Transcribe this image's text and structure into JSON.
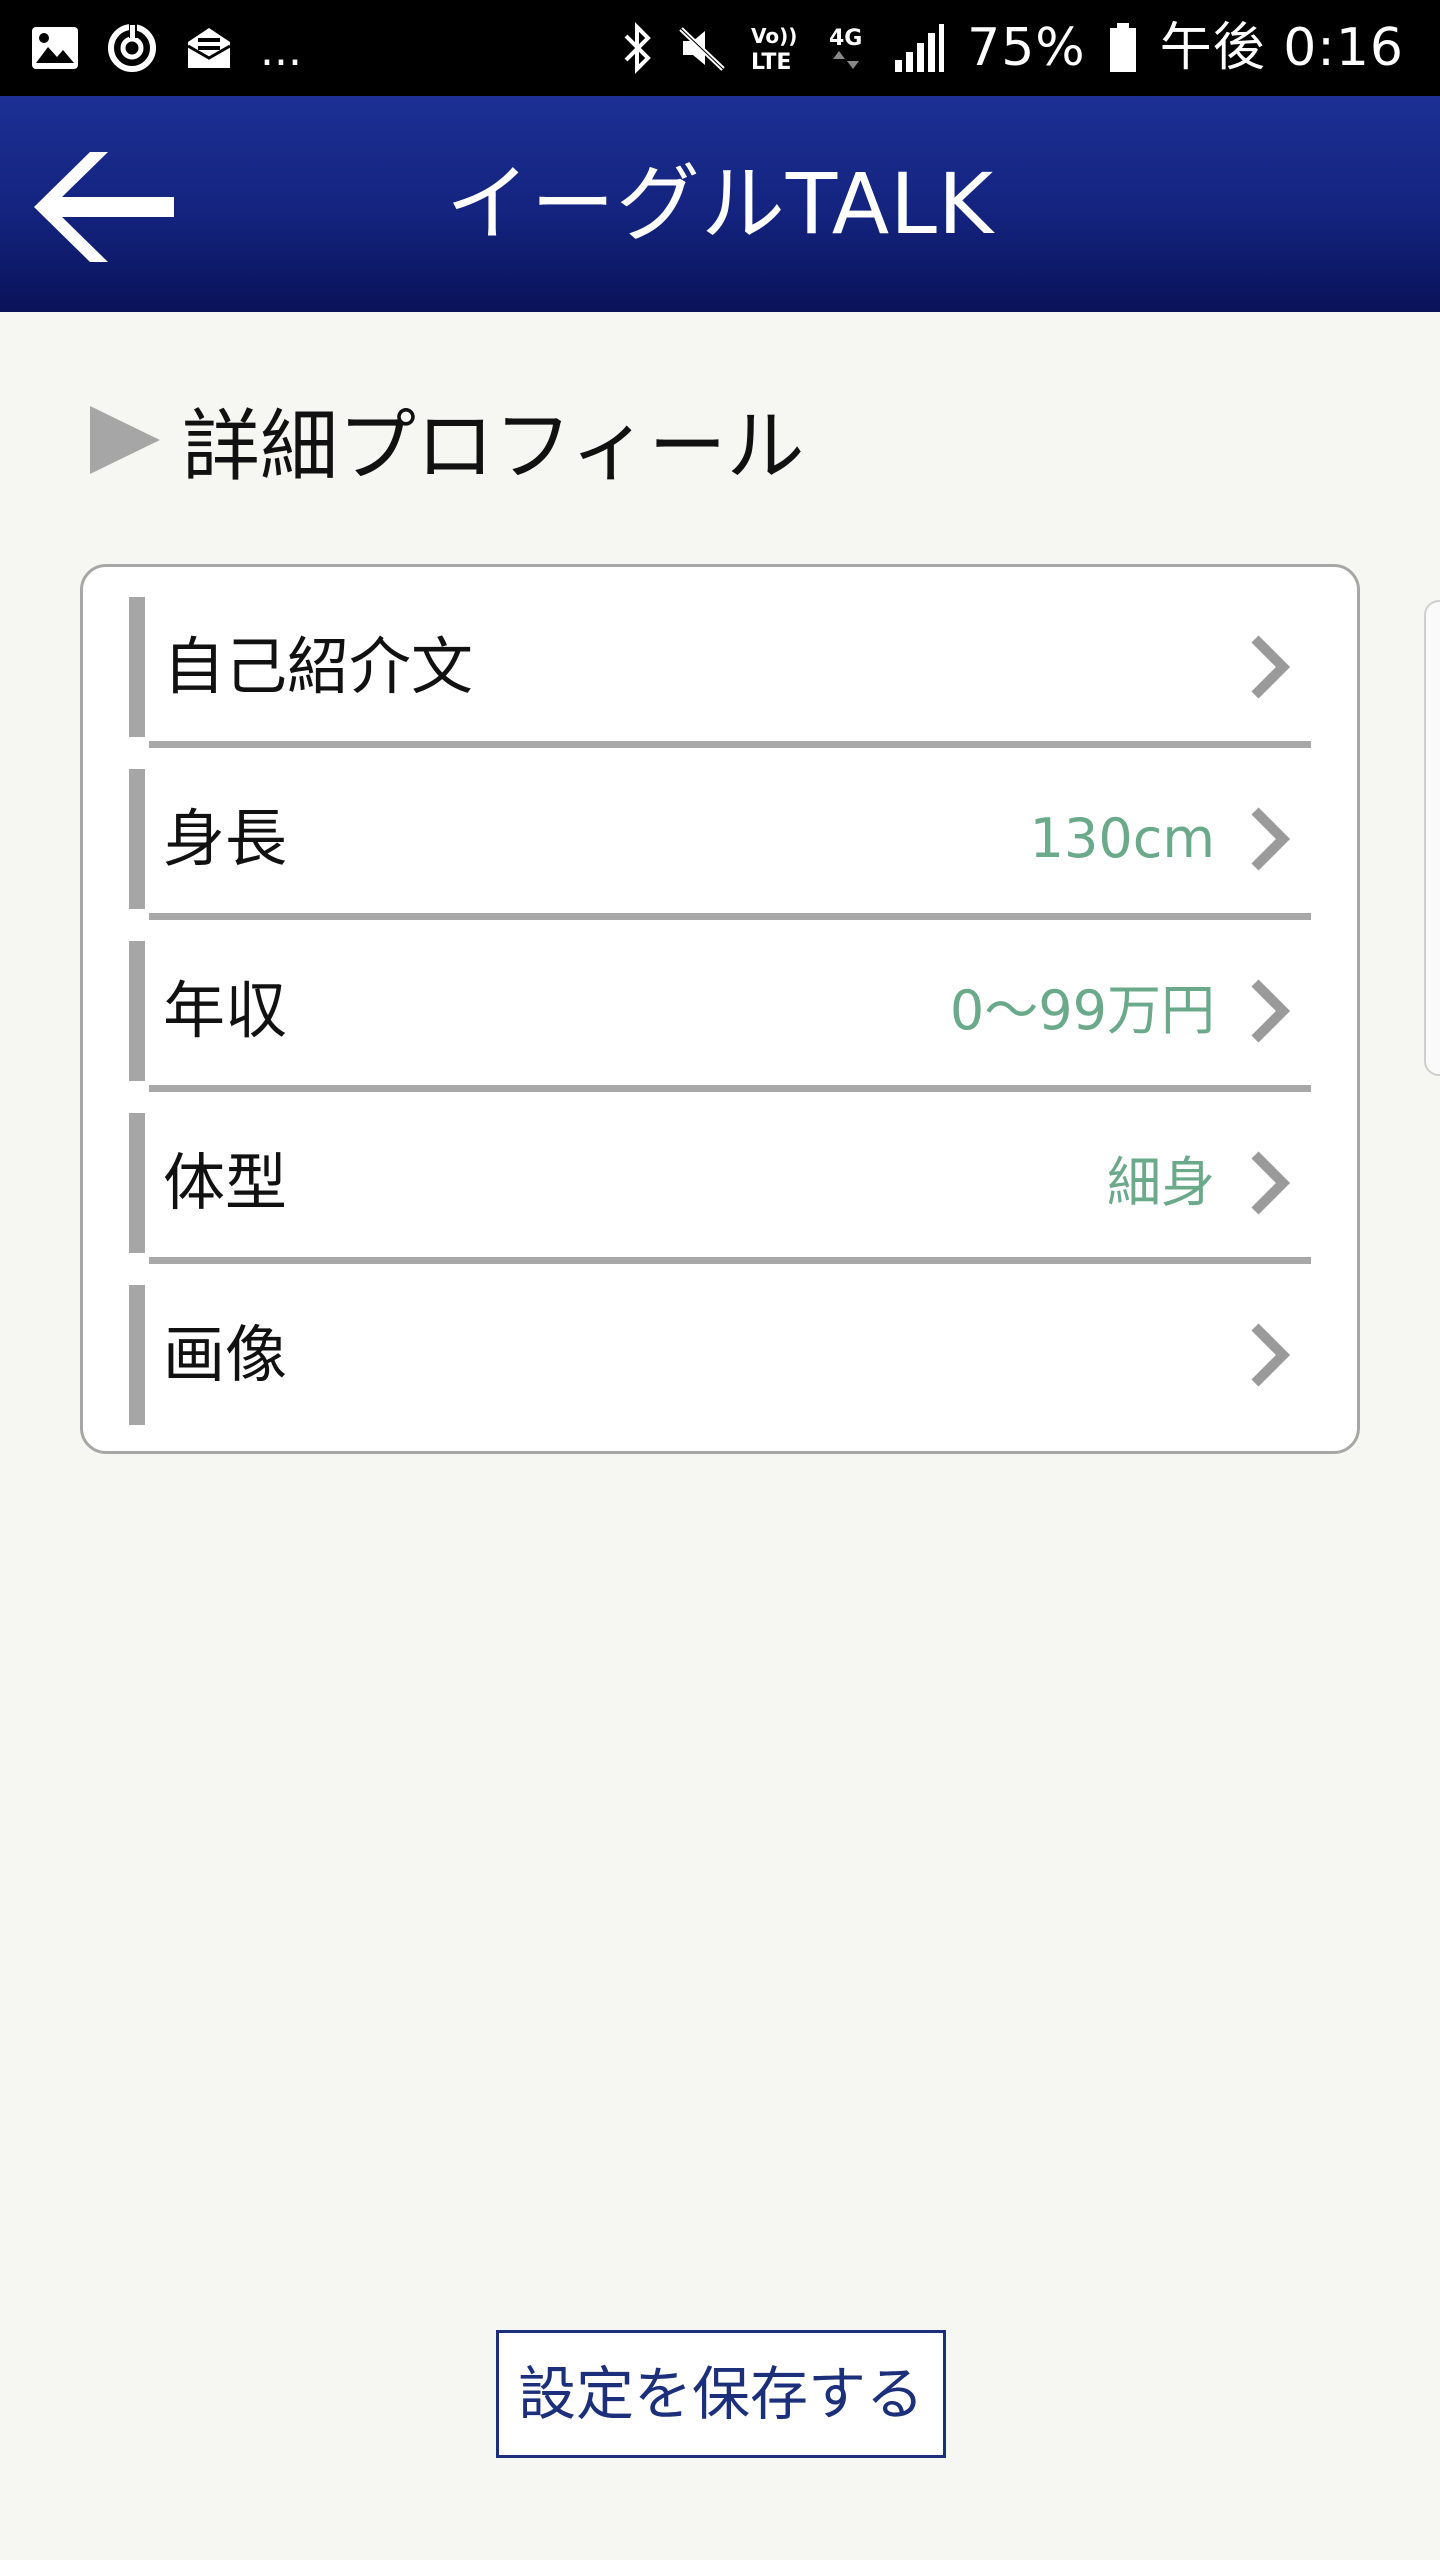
{
  "status_bar": {
    "left_icons": [
      "image-icon",
      "sync-icon",
      "mail-icon"
    ],
    "more": "...",
    "right_icons": [
      "bluetooth-icon",
      "mute-icon",
      "volte-icon",
      "4g-icon",
      "signal-icon"
    ],
    "volte_label": "Vo)) LTE",
    "network_label": "4G",
    "battery": "75%",
    "time": "午後 0:16"
  },
  "header": {
    "title": "イーグルTALK",
    "back_icon": "arrow-left-icon",
    "color": "#13237e"
  },
  "section": {
    "title": "詳細プロフィール"
  },
  "profile_rows": [
    {
      "label": "自己紹介文",
      "value": ""
    },
    {
      "label": "身長",
      "value": "130cm"
    },
    {
      "label": "年収",
      "value": "0〜99万円"
    },
    {
      "label": "体型",
      "value": "細身"
    },
    {
      "label": "画像",
      "value": ""
    }
  ],
  "value_color": "#6aa98a",
  "save_button": {
    "label": "設定を保存する"
  }
}
